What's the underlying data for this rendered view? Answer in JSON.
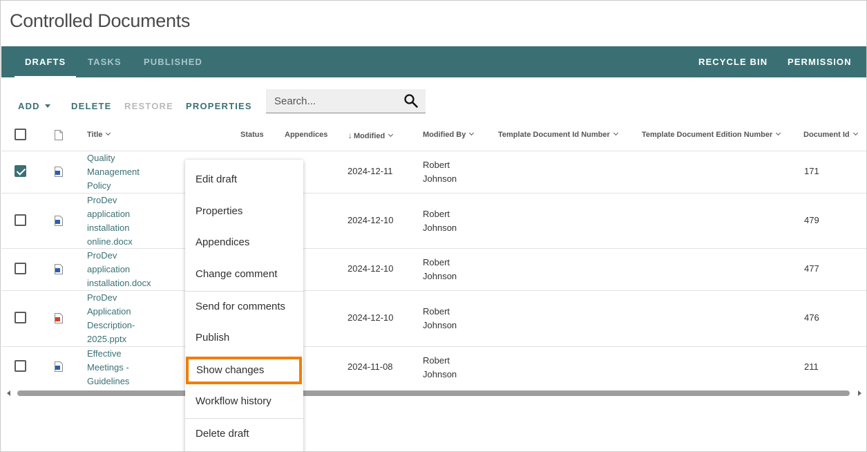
{
  "page": {
    "title": "Controlled Documents"
  },
  "nav": {
    "tabs": [
      "DRAFTS",
      "TASKS",
      "PUBLISHED"
    ],
    "active_tab": "DRAFTS",
    "right": [
      "RECYCLE BIN",
      "PERMISSION"
    ],
    "bg_color": "#3a7074"
  },
  "toolbar": {
    "add": "ADD",
    "delete": "DELETE",
    "restore": "RESTORE",
    "properties": "PROPERTIES",
    "restore_disabled": true
  },
  "search": {
    "placeholder": "Search...",
    "icon": "search-icon"
  },
  "table": {
    "columns": [
      "Title",
      "Status",
      "Appendices",
      "Modified",
      "Modified By",
      "Template Document Id Number",
      "Template Document Edition Number",
      "Document Id"
    ],
    "sort": {
      "column": "Modified",
      "direction": "descending"
    },
    "rows": [
      {
        "checked": true,
        "file_type": "word",
        "title": "Quality\nManagement\nPolicy",
        "status": "",
        "appendices": "",
        "modified": "2024-12-11",
        "modified_by": "Robert\nJohnson",
        "template_id": "",
        "template_edition": "",
        "document_id": "171"
      },
      {
        "checked": false,
        "file_type": "word",
        "title": "ProDev\napplication\ninstallation\nonline.docx",
        "status": "",
        "appendices": "",
        "modified": "2024-12-10",
        "modified_by": "Robert\nJohnson",
        "template_id": "",
        "template_edition": "",
        "document_id": "479"
      },
      {
        "checked": false,
        "file_type": "word",
        "title": "ProDev\napplication\ninstallation.docx",
        "status": "",
        "appendices": "",
        "modified": "2024-12-10",
        "modified_by": "Robert\nJohnson",
        "template_id": "",
        "template_edition": "",
        "document_id": "477"
      },
      {
        "checked": false,
        "file_type": "powerpoint",
        "title": "ProDev\nApplication\nDescription-\n2025.pptx",
        "status": "",
        "appendices": "",
        "modified": "2024-12-10",
        "modified_by": "Robert\nJohnson",
        "template_id": "",
        "template_edition": "",
        "document_id": "476"
      },
      {
        "checked": false,
        "file_type": "word",
        "title": "Effective\nMeetings -\nGuidelines",
        "status": "",
        "appendices": "",
        "modified": "2024-11-08",
        "modified_by": "Robert\nJohnson",
        "template_id": "",
        "template_edition": "",
        "document_id": "211"
      }
    ]
  },
  "context_menu": {
    "items": [
      "Edit draft",
      "Properties",
      "Appendices",
      "Change comment",
      "Send for comments",
      "Publish",
      "Show changes",
      "Workflow history",
      "Delete draft"
    ],
    "highlighted": "Show changes",
    "highlight_color": "#f27d00"
  }
}
